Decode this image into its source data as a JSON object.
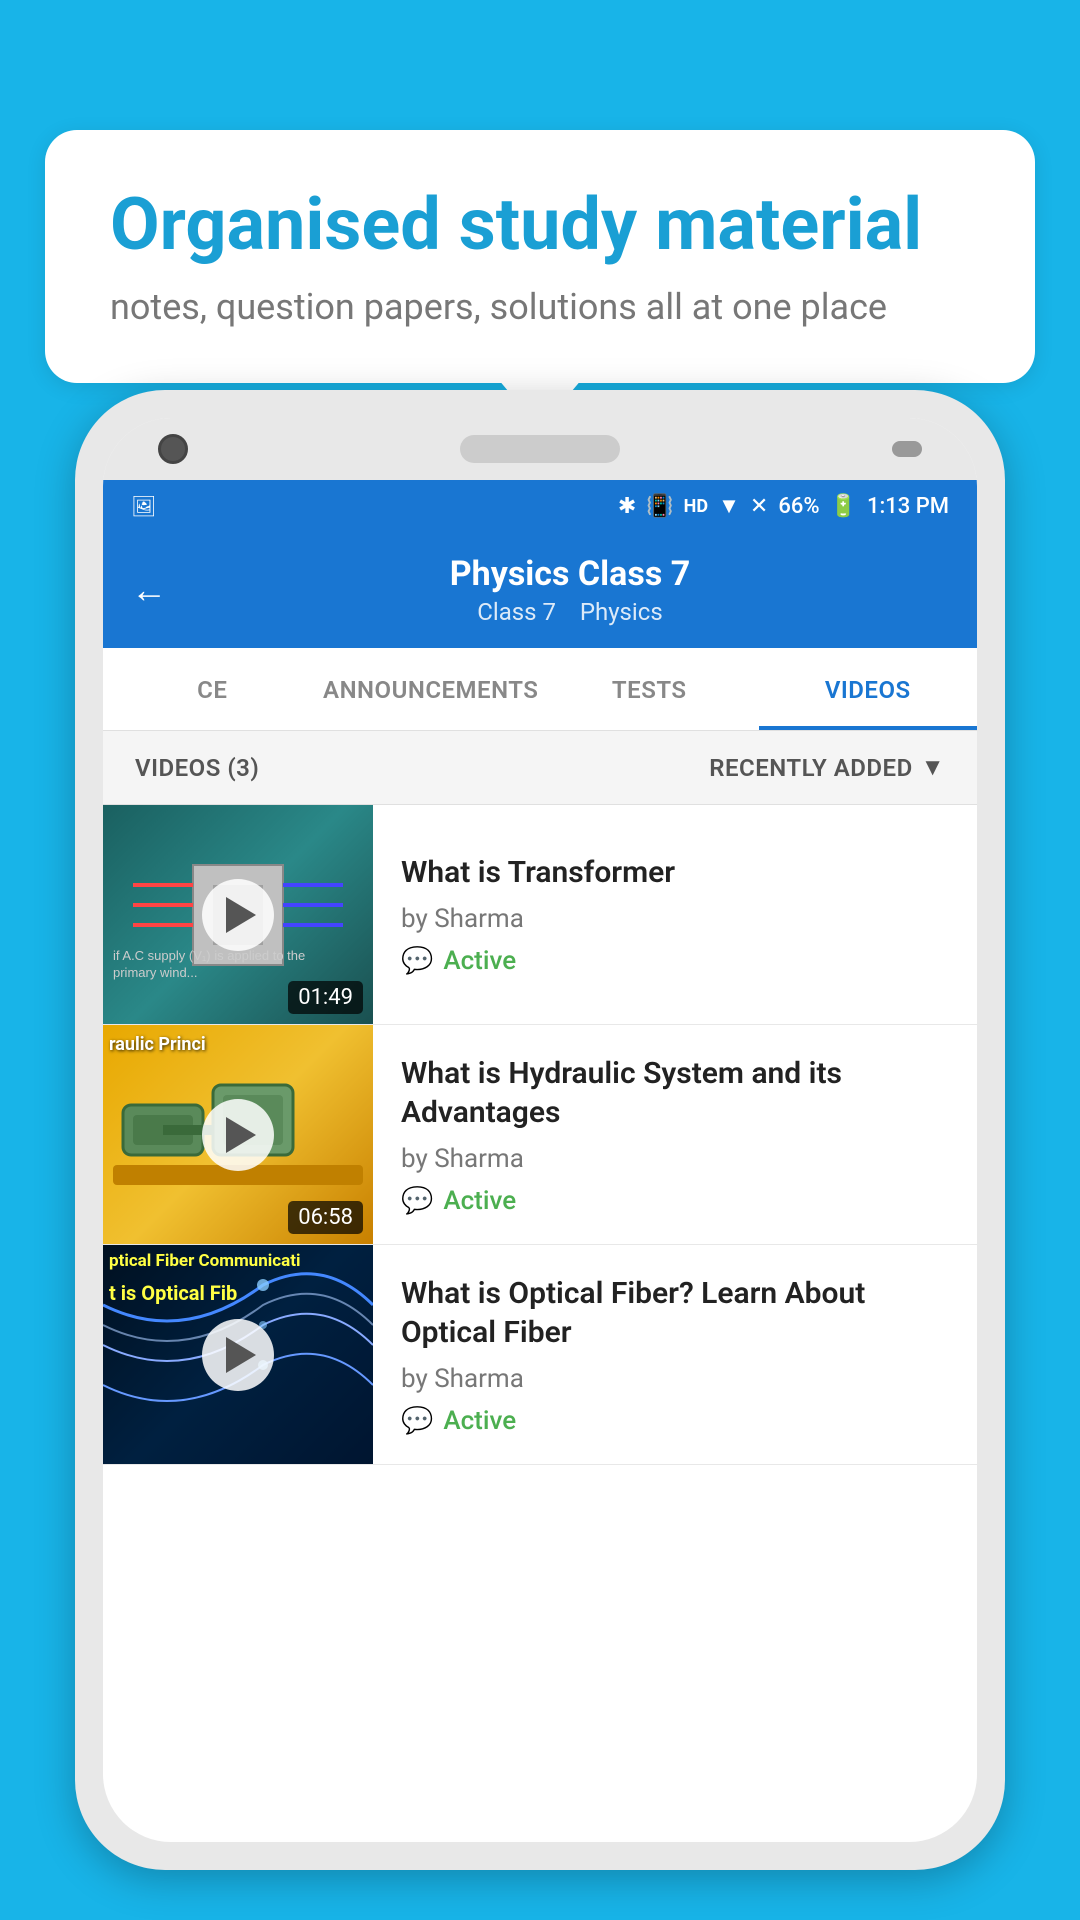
{
  "background_color": "#18b4e8",
  "bubble": {
    "title": "Organised study material",
    "subtitle": "notes, question papers, solutions all at one place"
  },
  "status_bar": {
    "time": "1:13 PM",
    "battery": "66%",
    "signal_icons": "🔵📶📶"
  },
  "toolbar": {
    "title": "Physics Class 7",
    "subtitle_class": "Class 7",
    "subtitle_subject": "Physics",
    "back_label": "←"
  },
  "tabs": [
    {
      "label": "CE",
      "active": false
    },
    {
      "label": "ANNOUNCEMENTS",
      "active": false
    },
    {
      "label": "TESTS",
      "active": false
    },
    {
      "label": "VIDEOS",
      "active": true
    }
  ],
  "list_header": {
    "count_label": "VIDEOS (3)",
    "sort_label": "RECENTLY ADDED",
    "sort_icon": "▼"
  },
  "videos": [
    {
      "title": "What is  Transformer",
      "author": "by Sharma",
      "status": "Active",
      "duration": "01:49",
      "thumb_type": "transformer"
    },
    {
      "title": "What is Hydraulic System and its Advantages",
      "author": "by Sharma",
      "status": "Active",
      "duration": "06:58",
      "thumb_type": "hydraulic",
      "thumb_label": "raulic Princi"
    },
    {
      "title": "What is Optical Fiber? Learn About Optical Fiber",
      "author": "by Sharma",
      "status": "Active",
      "duration": "",
      "thumb_type": "fiber",
      "thumb_label": "ptical Fiber Communicati"
    }
  ]
}
